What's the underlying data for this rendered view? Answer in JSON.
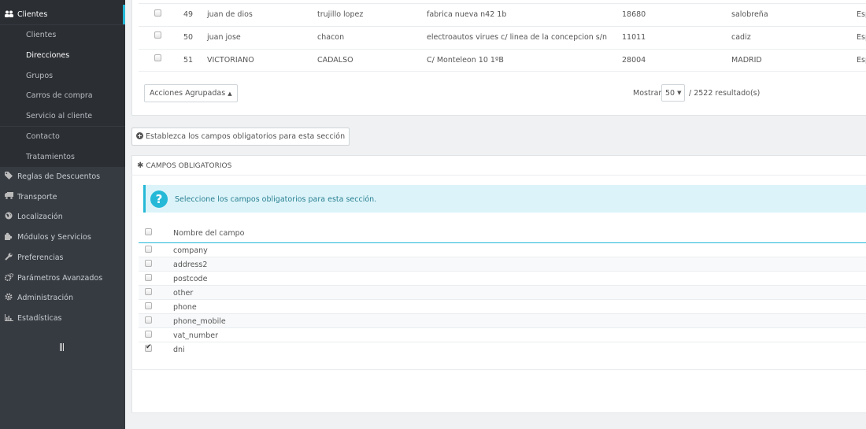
{
  "sidebar": {
    "clientes": {
      "label": "Clientes",
      "icon": "users-icon"
    },
    "sub_items": [
      "Clientes",
      "Direcciones",
      "Grupos",
      "Carros de compra",
      "Servicio al cliente",
      "Contacto",
      "Tratamientos"
    ],
    "active_sub": "Direcciones",
    "main_items": [
      {
        "label": "Reglas de Descuentos",
        "icon": "tag-icon"
      },
      {
        "label": "Transporte",
        "icon": "truck-icon"
      },
      {
        "label": "Localización",
        "icon": "globe-icon"
      },
      {
        "label": "Módulos y Servicios",
        "icon": "puzzle-icon"
      },
      {
        "label": "Preferencias",
        "icon": "wrench-icon"
      },
      {
        "label": "Parámetros Avanzados",
        "icon": "cogs-icon"
      },
      {
        "label": "Administración",
        "icon": "gear-icon"
      },
      {
        "label": "Estadísticas",
        "icon": "bar-chart-icon"
      }
    ]
  },
  "addresses": {
    "rows": [
      {
        "id": "49",
        "first": "juan de dios",
        "last": "trujillo lopez",
        "address": "fabrica nueva n42 1b",
        "postcode": "18680",
        "city": "salobreña",
        "country": "Esp"
      },
      {
        "id": "50",
        "first": "juan jose",
        "last": "chacon",
        "address": "electroautos virues c/ linea de la concepcion s/n",
        "postcode": "11011",
        "city": "cadiz",
        "country": "Esp"
      },
      {
        "id": "51",
        "first": "VICTORIANO",
        "last": "CADALSO",
        "address": "C/ Monteleon 10 1ºB",
        "postcode": "28004",
        "city": "MADRID",
        "country": "Esp"
      }
    ],
    "bulk_actions_label": "Acciones Agrupadas",
    "show_label": "Mostrar",
    "per_page": "50",
    "results_label": "/ 2522 resultado(s)"
  },
  "required_fields": {
    "toggle_button": "Establezca los campos obligatorios para esta sección",
    "panel_title": "CAMPOS OBLIGATORIOS",
    "info_text": "Seleccione los campos obligatorios para esta sección.",
    "column_header": "Nombre del campo",
    "fields": [
      {
        "name": "company",
        "checked": false
      },
      {
        "name": "address2",
        "checked": false
      },
      {
        "name": "postcode",
        "checked": false
      },
      {
        "name": "other",
        "checked": false
      },
      {
        "name": "phone",
        "checked": false
      },
      {
        "name": "phone_mobile",
        "checked": false
      },
      {
        "name": "vat_number",
        "checked": false
      },
      {
        "name": "dni",
        "checked": true
      }
    ]
  },
  "colors": {
    "sidebar_bg": "#363a41",
    "accent": "#25b9d7",
    "info_bg": "#dcf4f9"
  }
}
